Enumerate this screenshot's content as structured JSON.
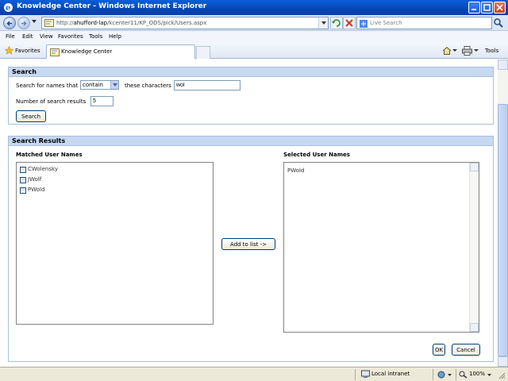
{
  "window": {
    "title": "Knowledge Center - Windows Internet Explorer"
  },
  "addressbar": {
    "url_prefix": "http://",
    "url_host": "ahufford-lap",
    "url_path": "/kcenter11/KP_ODS/pick/Users.aspx"
  },
  "searchbox": {
    "placeholder": "Live Search"
  },
  "menu": {
    "items": [
      "File",
      "Edit",
      "View",
      "Favorites",
      "Tools",
      "Help"
    ]
  },
  "favbar": {
    "favorites_label": "Favorites",
    "tab_label": "Knowledge Center",
    "tools_label": "Tools"
  },
  "search_panel": {
    "title": "Search",
    "names_label": "Search for names that",
    "match_mode": "contain",
    "chars_label": "these characters",
    "chars_value": "wol",
    "count_label": "Number of search results",
    "count_value": "5",
    "search_button": "Search"
  },
  "results_panel": {
    "title": "Search Results",
    "matched_label": "Matched User Names",
    "selected_label": "Selected User Names",
    "matched_users": [
      "CWolensky",
      "JWolf",
      "PWold"
    ],
    "selected_users": [
      "PWold"
    ],
    "add_button": "Add to list ->",
    "ok_button": "OK",
    "cancel_button": "Cancel"
  },
  "statusbar": {
    "zone": "Local intranet",
    "zoom": "100%"
  },
  "colors": {
    "titlebar": "#0745b8",
    "panel_header": "#c7d8f1",
    "panel_border": "#a9bfdc"
  }
}
